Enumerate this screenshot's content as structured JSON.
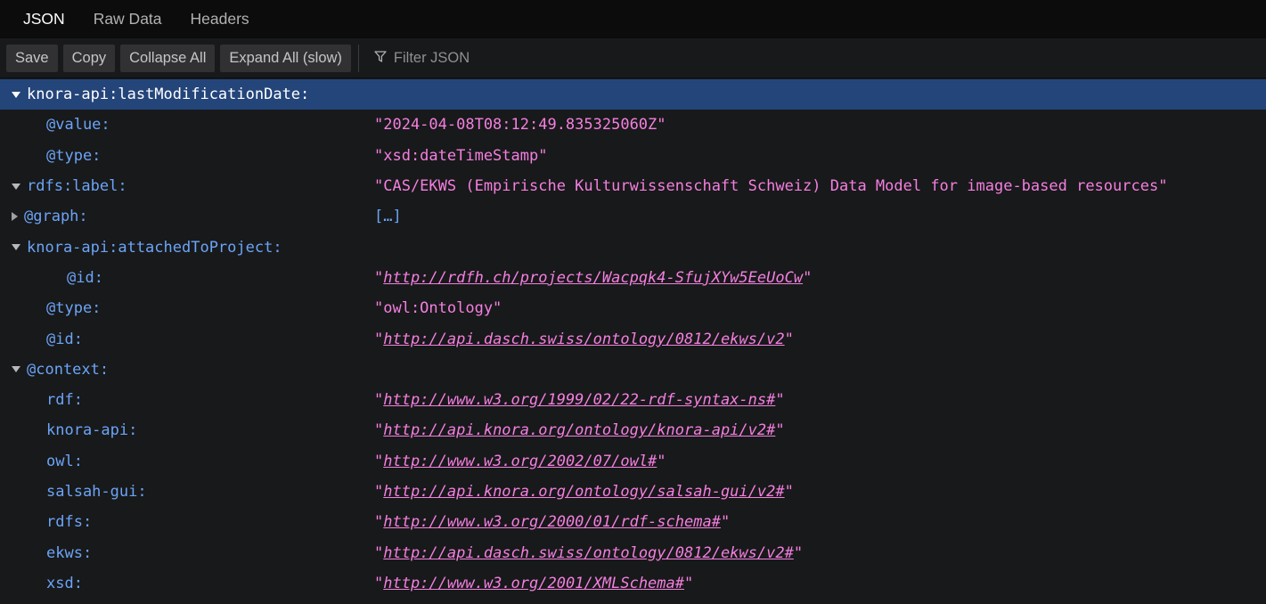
{
  "tabs": [
    {
      "label": "JSON",
      "active": true
    },
    {
      "label": "Raw Data",
      "active": false
    },
    {
      "label": "Headers",
      "active": false
    }
  ],
  "toolbar": {
    "save_label": "Save",
    "copy_label": "Copy",
    "collapse_all_label": "Collapse All",
    "expand_all_label": "Expand All (slow)",
    "filter_icon": "filter-icon",
    "filter_placeholder": "Filter JSON",
    "filter_value": ""
  },
  "colors": {
    "tabbar_bg": "#0c0c0d",
    "toolbar_bg": "#18191a",
    "panel_bg": "#18191a",
    "selection_bg": "#24457a",
    "key": "#6ba4f8",
    "string": "#f47fe0",
    "link": "#f47fe0",
    "button_bg": "#313134",
    "text": "#c5c5c8"
  },
  "json_rows": [
    {
      "key": "knora-api:lastModificationDate:",
      "value": "",
      "type": "none",
      "twisty": "open",
      "indent": 0,
      "selected": true
    },
    {
      "key": "@value:",
      "value": "\"2024-04-08T08:12:49.835325060Z\"",
      "type": "string",
      "twisty": "none",
      "indent": 1,
      "selected": false
    },
    {
      "key": "@type:",
      "value": "\"xsd:dateTimeStamp\"",
      "type": "string",
      "twisty": "none",
      "indent": 1,
      "selected": false
    },
    {
      "key": "rdfs:label:",
      "value": "\"CAS/EKWS (Empirische Kulturwissenschaft Schweiz) Data Model for image-based resources\"",
      "type": "string",
      "twisty": "open",
      "indent": 0,
      "selected": false
    },
    {
      "key": "@graph:",
      "value": "[…]",
      "type": "collapsed",
      "twisty": "closed",
      "indent": 0,
      "selected": false
    },
    {
      "key": "knora-api:attachedToProject:",
      "value": "",
      "type": "none",
      "twisty": "open",
      "indent": 0,
      "selected": false
    },
    {
      "key": "@id:",
      "value": "http://rdfh.ch/projects/Wacpqk4-SfujXYw5EeUoCw",
      "type": "link",
      "twisty": "none",
      "indent": 2,
      "selected": false
    },
    {
      "key": "@type:",
      "value": "\"owl:Ontology\"",
      "type": "string",
      "twisty": "none",
      "indent": 1,
      "selected": false
    },
    {
      "key": "@id:",
      "value": "http://api.dasch.swiss/ontology/0812/ekws/v2",
      "type": "link",
      "twisty": "none",
      "indent": 1,
      "selected": false
    },
    {
      "key": "@context:",
      "value": "",
      "type": "none",
      "twisty": "open",
      "indent": 0,
      "selected": false
    },
    {
      "key": "rdf:",
      "value": "http://www.w3.org/1999/02/22-rdf-syntax-ns#",
      "type": "link",
      "twisty": "none",
      "indent": 1,
      "selected": false
    },
    {
      "key": "knora-api:",
      "value": "http://api.knora.org/ontology/knora-api/v2#",
      "type": "link",
      "twisty": "none",
      "indent": 1,
      "selected": false
    },
    {
      "key": "owl:",
      "value": "http://www.w3.org/2002/07/owl#",
      "type": "link",
      "twisty": "none",
      "indent": 1,
      "selected": false
    },
    {
      "key": "salsah-gui:",
      "value": "http://api.knora.org/ontology/salsah-gui/v2#",
      "type": "link",
      "twisty": "none",
      "indent": 1,
      "selected": false
    },
    {
      "key": "rdfs:",
      "value": "http://www.w3.org/2000/01/rdf-schema#",
      "type": "link",
      "twisty": "none",
      "indent": 1,
      "selected": false
    },
    {
      "key": "ekws:",
      "value": "http://api.dasch.swiss/ontology/0812/ekws/v2#",
      "type": "link",
      "twisty": "none",
      "indent": 1,
      "selected": false
    },
    {
      "key": "xsd:",
      "value": "http://www.w3.org/2001/XMLSchema#",
      "type": "link",
      "twisty": "none",
      "indent": 1,
      "selected": false
    }
  ]
}
